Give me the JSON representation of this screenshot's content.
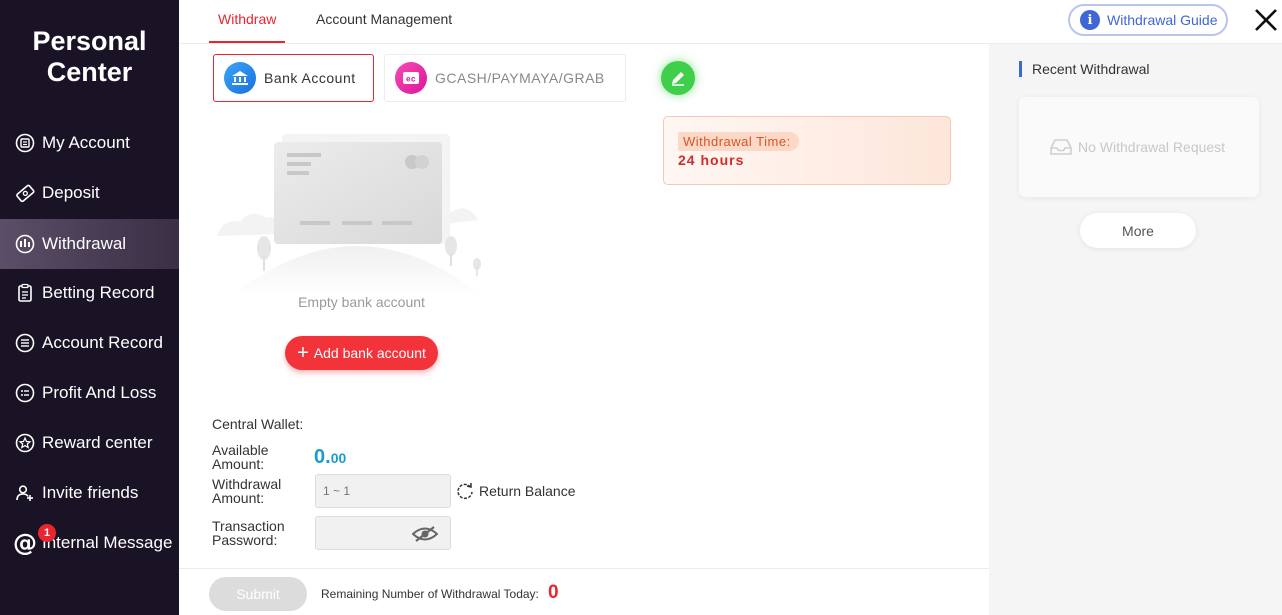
{
  "sidebar": {
    "title_line1": "Personal",
    "title_line2": "Center",
    "items": [
      {
        "label": "My Account",
        "icon": "account-icon"
      },
      {
        "label": "Deposit",
        "icon": "deposit-icon"
      },
      {
        "label": "Withdrawal",
        "icon": "withdrawal-icon",
        "active": true
      },
      {
        "label": "Betting Record",
        "icon": "betting-record-icon"
      },
      {
        "label": "Account Record",
        "icon": "account-record-icon"
      },
      {
        "label": "Profit And Loss",
        "icon": "profit-loss-icon"
      },
      {
        "label": "Reward center",
        "icon": "reward-icon"
      },
      {
        "label": "Invite friends",
        "icon": "invite-icon"
      },
      {
        "label": "Internal Message",
        "icon": "at-icon",
        "badge": "1"
      }
    ]
  },
  "header": {
    "tabs": [
      {
        "label": "Withdraw",
        "active": true
      },
      {
        "label": "Account Management",
        "active": false
      }
    ],
    "guide_label": "Withdrawal Guide",
    "guide_icon": "i"
  },
  "methods": {
    "bank_label": "Bank Account",
    "gcash_label": "GCASH/PAYMAYA/GRAB"
  },
  "withdrawal_time": {
    "label": "Withdrawal Time:",
    "value": "24 hours"
  },
  "empty_state": {
    "text": "Empty bank account",
    "add_label": "Add bank account"
  },
  "form": {
    "central_wallet_label": "Central Wallet:",
    "available_label_1": "Available",
    "available_label_2": "Amount:",
    "available_int": "0.",
    "available_dec": "00",
    "withdrawal_label_1": "Withdrawal",
    "withdrawal_label_2": "Amount:",
    "withdrawal_placeholder": "1 ~ 1",
    "return_balance": "Return Balance",
    "password_label_1": "Transaction",
    "password_label_2": "Password:"
  },
  "footer": {
    "submit_label": "Submit",
    "remaining_label": "Remaining Number of Withdrawal Today:",
    "remaining_count": "0"
  },
  "recent": {
    "title": "Recent Withdrawal",
    "empty_text": "No Withdrawal Request",
    "more_label": "More"
  },
  "colors": {
    "accent_red": "#e8262f",
    "sidebar_bg": "#1a1325",
    "link_blue": "#3f66d6",
    "amount_blue": "#1b9bd1",
    "edit_green": "#3fcf4a"
  }
}
